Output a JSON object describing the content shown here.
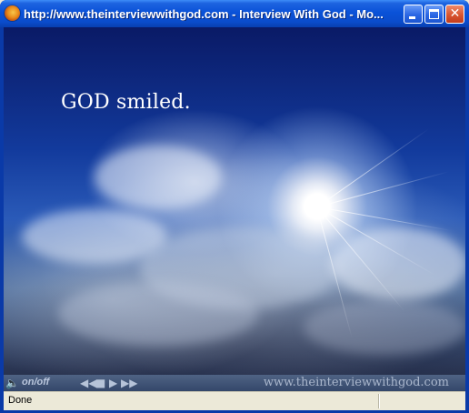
{
  "window": {
    "title": "http://www.theinterviewwithgod.com - Interview With God - Mo...",
    "icon": "firefox-icon"
  },
  "titlebar_buttons": {
    "minimize_icon": "minimize-icon",
    "maximize_icon": "maximize-icon",
    "close_glyph": "✕"
  },
  "content": {
    "headline": "GOD smiled."
  },
  "player": {
    "speaker_glyph": "🔈",
    "onoff_label": "on/off",
    "rewind_glyph": "◀◀",
    "stop_glyph": "■",
    "play_glyph": "▶",
    "forward_glyph": "▶▶",
    "site_text": "www.theinterviewwithgod.com"
  },
  "statusbar": {
    "text": "Done"
  },
  "colors": {
    "titlebar": "#0a52d8",
    "player_bg": "#3b4e70",
    "statusbar_bg": "#ece9d8"
  }
}
